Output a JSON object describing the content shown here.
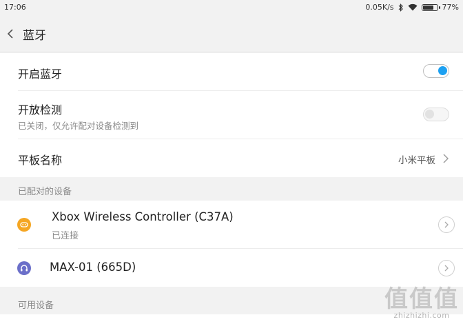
{
  "status_bar": {
    "time": "17:06",
    "network_speed": "0.05K/s",
    "battery_percent": "77%",
    "battery_level": 0.77,
    "icons": [
      "bluetooth-icon",
      "wifi-icon",
      "battery-icon"
    ]
  },
  "nav": {
    "title": "蓝牙",
    "back_icon": "chevron-left-icon"
  },
  "settings": {
    "bluetooth_toggle": {
      "label": "开启蓝牙",
      "state": "on"
    },
    "discoverable": {
      "label": "开放检测",
      "sub": "已关闭，仅允许配对设备检测到",
      "state": "off"
    },
    "device_name": {
      "label": "平板名称",
      "value": "小米平板"
    }
  },
  "paired_section": {
    "header": "已配对的设备",
    "devices": [
      {
        "name": "Xbox Wireless Controller (C37A)",
        "status": "已连接",
        "icon": "gamepad-icon",
        "icon_color": "#f5a623"
      },
      {
        "name": "MAX-01 (665D)",
        "status": "",
        "icon": "headphones-icon",
        "icon_color": "#6b6fc9"
      }
    ]
  },
  "available_section": {
    "header": "可用设备"
  },
  "watermark": {
    "chars": "值值值",
    "url": "zhizhizhi.com"
  },
  "colors": {
    "accent": "#1da1f2",
    "background": "#f2f2f2"
  }
}
